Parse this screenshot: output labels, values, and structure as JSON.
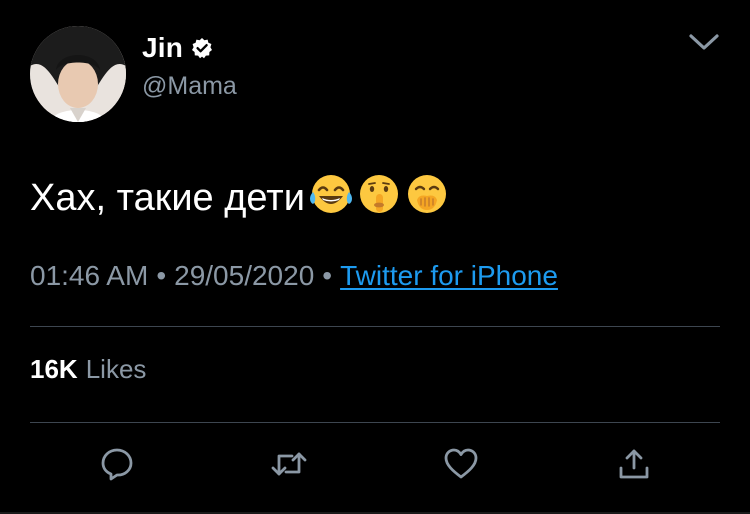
{
  "author": {
    "display_name": "Jin",
    "handle": "@Mama",
    "verified": true,
    "avatar_icon": "avatar-photo"
  },
  "menu": {
    "icon": "chevron-down-icon"
  },
  "tweet": {
    "text": "Хах, такие дети",
    "emojis": [
      "face-with-tears-of-joy",
      "shushing-face",
      "face-with-hand-over-mouth"
    ]
  },
  "meta": {
    "time": "01:46 AM",
    "separator": "•",
    "date": "29/05/2020",
    "source": "Twitter for iPhone"
  },
  "stats": {
    "likes_count": "16K",
    "likes_label": "Likes"
  },
  "actions": {
    "reply_icon": "reply-icon",
    "retweet_icon": "retweet-icon",
    "like_icon": "heart-icon",
    "share_icon": "share-icon"
  },
  "colors": {
    "background": "#000000",
    "text": "#ffffff",
    "secondary": "#8b98a5",
    "link": "#1d9bf0",
    "divider": "#3d4650"
  }
}
